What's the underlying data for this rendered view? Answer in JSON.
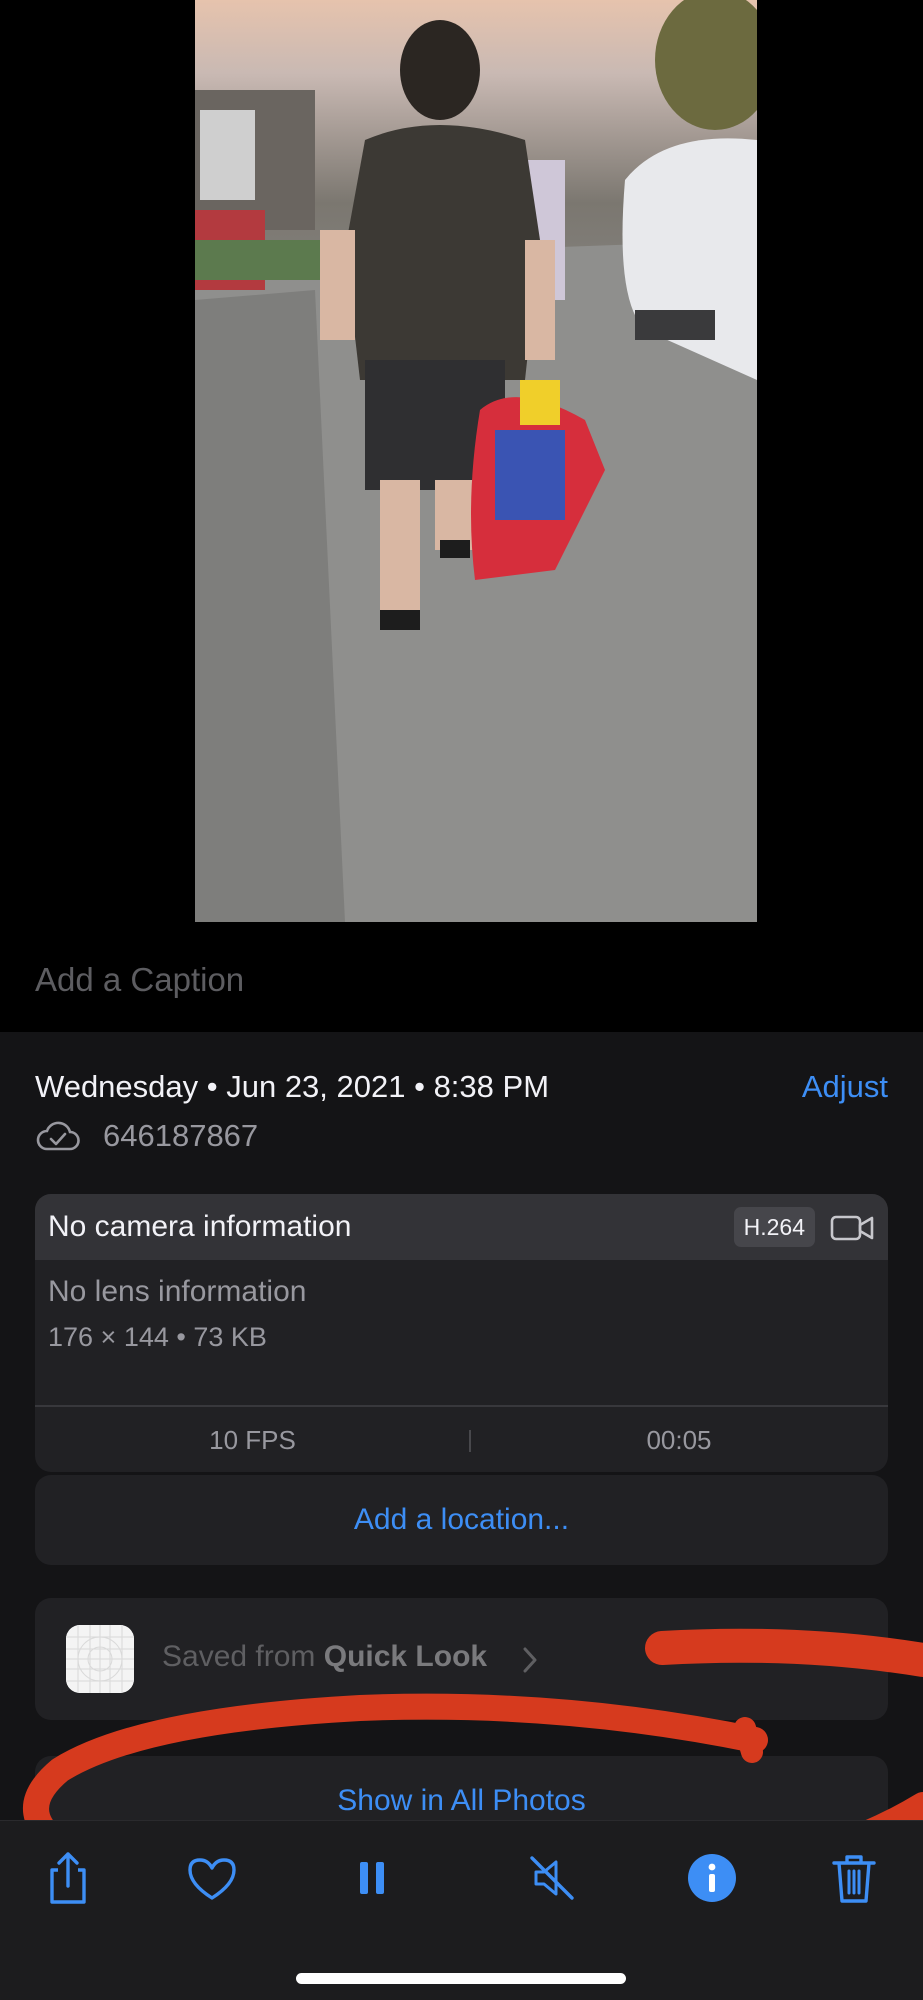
{
  "caption": {
    "placeholder": "Add a Caption"
  },
  "info": {
    "date_line": "Wednesday • Jun 23, 2021 • 8:38 PM",
    "adjust_label": "Adjust",
    "filename": "646187867"
  },
  "meta": {
    "camera_info": "No camera information",
    "codec": "H.264",
    "lens_info": "No lens information",
    "dimensions": "176 × 144  •  73 KB",
    "fps": "10 FPS",
    "duration": "00:05"
  },
  "location": {
    "label": "Add a location..."
  },
  "saved_from": {
    "prefix": "Saved from ",
    "app": "Quick Look"
  },
  "show_all_label": "Show in All Photos",
  "toolbar": {
    "items": [
      "share-icon",
      "heart-icon",
      "pause-icon",
      "muted-speaker-icon",
      "info-icon",
      "trash-icon"
    ]
  },
  "colors": {
    "accent": "#3d8ef5",
    "annotation": "#d63a1e",
    "sheet_background": "#141416",
    "card_background": "#212124"
  }
}
